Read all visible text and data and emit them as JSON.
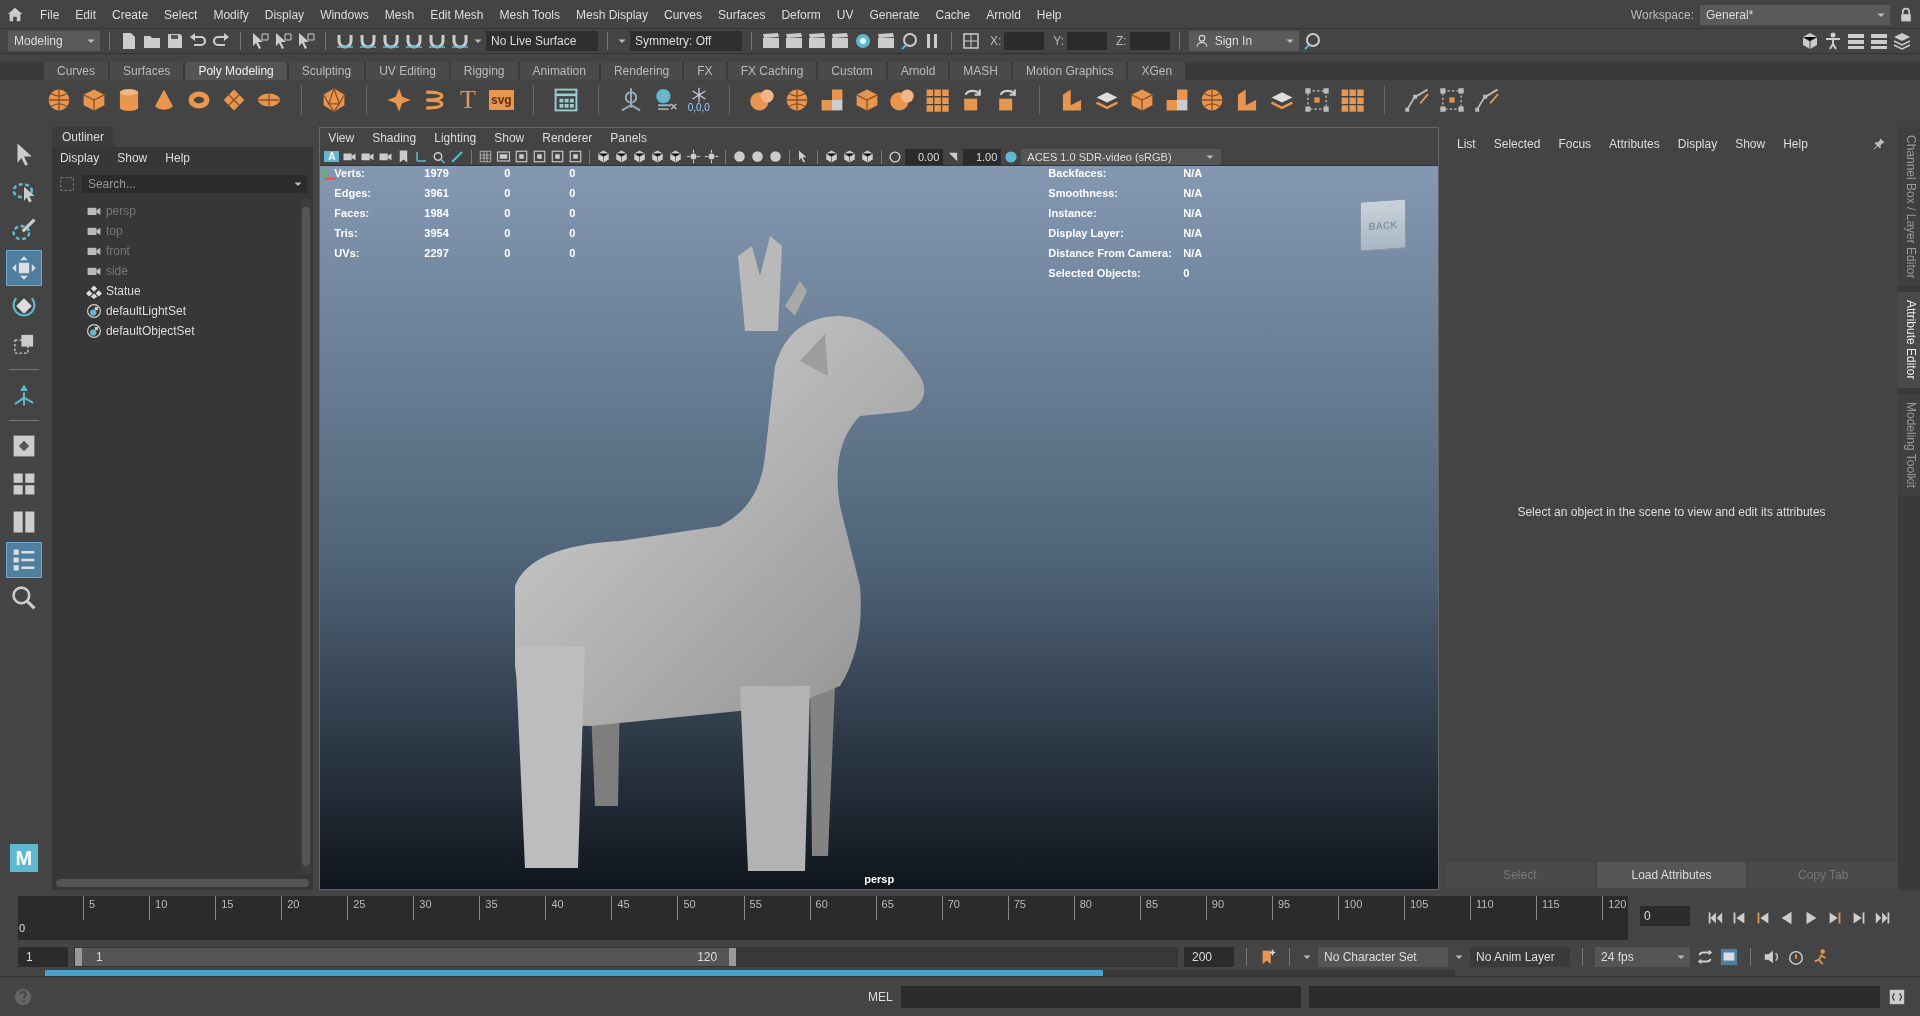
{
  "menu_bar": {
    "items": [
      "File",
      "Edit",
      "Create",
      "Select",
      "Modify",
      "Display",
      "Windows",
      "Mesh",
      "Edit Mesh",
      "Mesh Tools",
      "Mesh Display",
      "Curves",
      "Surfaces",
      "Deform",
      "UV",
      "Generate",
      "Cache",
      "Arnold",
      "Help"
    ],
    "workspace_label": "Workspace:",
    "workspace": "General*"
  },
  "status_line": {
    "mode": "Modeling",
    "live_surface": "No Live Surface",
    "symmetry": "Symmetry: Off",
    "coord_labels": [
      "X:",
      "Y:",
      "Z:"
    ],
    "sign_in": "Sign In"
  },
  "shelf": {
    "tabs": [
      {
        "label": "Curves",
        "selected": false
      },
      {
        "label": "Surfaces",
        "selected": false
      },
      {
        "label": "Poly Modeling",
        "selected": true
      },
      {
        "label": "Sculpting",
        "selected": false
      },
      {
        "label": "UV Editing",
        "selected": false
      },
      {
        "label": "Rigging",
        "selected": false
      },
      {
        "label": "Animation",
        "selected": false
      },
      {
        "label": "Rendering",
        "selected": false
      },
      {
        "label": "FX",
        "selected": false
      },
      {
        "label": "FX Caching",
        "selected": false
      },
      {
        "label": "Custom",
        "selected": false
      },
      {
        "label": "Arnold",
        "selected": false
      },
      {
        "label": "MASH",
        "selected": false
      },
      {
        "label": "Motion Graphics",
        "selected": false
      },
      {
        "label": "XGen",
        "selected": false
      }
    ],
    "icons": [
      {
        "kind": "sphere"
      },
      {
        "kind": "cube"
      },
      {
        "kind": "cylinder"
      },
      {
        "kind": "cone"
      },
      {
        "kind": "torus"
      },
      {
        "kind": "diamond"
      },
      {
        "kind": "disc"
      },
      {
        "kind": "separator"
      },
      {
        "kind": "poly"
      },
      {
        "kind": "separator"
      },
      {
        "kind": "star"
      },
      {
        "kind": "helix"
      },
      {
        "kind": "glyph",
        "text": "T"
      },
      {
        "kind": "badge",
        "text": "svg"
      },
      {
        "kind": "separator"
      },
      {
        "kind": "panel"
      },
      {
        "kind": "separator"
      },
      {
        "kind": "pivot"
      },
      {
        "kind": "clock"
      },
      {
        "kind": "snap",
        "text": "0,0,0"
      },
      {
        "kind": "separator"
      },
      {
        "kind": "blob"
      },
      {
        "kind": "sphere"
      },
      {
        "kind": "blocks"
      },
      {
        "kind": "cube"
      },
      {
        "kind": "blob"
      },
      {
        "kind": "grid"
      },
      {
        "kind": "cycle"
      },
      {
        "kind": "cycle"
      },
      {
        "kind": "separator"
      },
      {
        "kind": "wedge"
      },
      {
        "kind": "layers"
      },
      {
        "kind": "cube"
      },
      {
        "kind": "blocks"
      },
      {
        "kind": "sphere"
      },
      {
        "kind": "wedge"
      },
      {
        "kind": "layers"
      },
      {
        "kind": "frame"
      },
      {
        "kind": "grid"
      },
      {
        "kind": "separator"
      },
      {
        "kind": "pen"
      },
      {
        "kind": "frame"
      },
      {
        "kind": "pen"
      }
    ]
  },
  "toolbox": {
    "tools": [
      {
        "kind": "select",
        "selected": false
      },
      {
        "kind": "lasso",
        "selected": false
      },
      {
        "kind": "paint",
        "selected": false
      },
      {
        "kind": "move",
        "selected": true
      },
      {
        "kind": "rotate",
        "selected": false
      },
      {
        "kind": "scale",
        "selected": false
      },
      {
        "kind": "separator"
      },
      {
        "kind": "manipulator",
        "selected": false
      },
      {
        "kind": "separator"
      },
      {
        "kind": "single",
        "selected": false
      },
      {
        "kind": "four",
        "selected": false
      },
      {
        "kind": "two",
        "selected": false
      },
      {
        "kind": "outliner",
        "selected": true
      },
      {
        "kind": "search",
        "selected": false
      }
    ],
    "logo": "M"
  },
  "outliner": {
    "title": "Outliner",
    "menu": [
      "Display",
      "Show",
      "Help"
    ],
    "search_placeholder": "Search...",
    "items": [
      {
        "label": "persp",
        "kind": "camera",
        "hidden": true
      },
      {
        "label": "top",
        "kind": "camera",
        "hidden": true
      },
      {
        "label": "front",
        "kind": "camera",
        "hidden": true
      },
      {
        "label": "side",
        "kind": "camera",
        "hidden": true
      },
      {
        "label": "Statue",
        "kind": "mesh",
        "hidden": false
      },
      {
        "label": "defaultLightSet",
        "kind": "set",
        "hidden": false
      },
      {
        "label": "defaultObjectSet",
        "kind": "set",
        "hidden": false
      }
    ]
  },
  "viewport": {
    "menu": [
      "View",
      "Shading",
      "Lighting",
      "Show",
      "Renderer",
      "Panels"
    ],
    "display_button": "A",
    "exposure": "0.00",
    "gamma": "1.00",
    "color_space": "ACES 1.0 SDR-video (sRGB)",
    "hud_left": [
      {
        "label": "Verts:",
        "values": [
          "1979",
          "0",
          "0"
        ]
      },
      {
        "label": "Edges:",
        "values": [
          "3961",
          "0",
          "0"
        ]
      },
      {
        "label": "Faces:",
        "values": [
          "1984",
          "0",
          "0"
        ]
      },
      {
        "label": "Tris:",
        "values": [
          "3954",
          "0",
          "0"
        ]
      },
      {
        "label": "UVs:",
        "values": [
          "2297",
          "0",
          "0"
        ]
      }
    ],
    "hud_right": [
      {
        "label": "Backfaces:",
        "value": "N/A"
      },
      {
        "label": "Smoothness:",
        "value": "N/A"
      },
      {
        "label": "Instance:",
        "value": "N/A"
      },
      {
        "label": "Display Layer:",
        "value": "N/A"
      },
      {
        "label": "Distance From Camera:",
        "value": "N/A"
      },
      {
        "label": "Selected Objects:",
        "value": "0"
      }
    ],
    "view_cube": "BACK",
    "camera": "persp"
  },
  "attribute_editor": {
    "menu": [
      "List",
      "Selected",
      "Focus",
      "Attributes",
      "Display",
      "Show",
      "Help"
    ],
    "message": "Select an object in the scene to view and edit its attributes",
    "buttons": [
      {
        "label": "Select",
        "disabled": true
      },
      {
        "label": "Load Attributes",
        "disabled": false
      },
      {
        "label": "Copy Tab",
        "disabled": true
      }
    ]
  },
  "side_tabs": [
    {
      "label": "Channel Box / Layer Editor",
      "selected": false
    },
    {
      "label": "Attribute Editor",
      "selected": true
    },
    {
      "label": "Modeling Toolkit",
      "selected": false
    }
  ],
  "time_slider": {
    "start": "0",
    "ticks": [
      "5",
      "10",
      "15",
      "20",
      "25",
      "30",
      "35",
      "40",
      "45",
      "50",
      "55",
      "60",
      "65",
      "70",
      "75",
      "80",
      "85",
      "90",
      "95",
      "100",
      "105",
      "110",
      "115",
      "120"
    ],
    "current_frame": "0"
  },
  "range_slider": {
    "start": "1",
    "range_start": "1",
    "range_end": "120",
    "end": "200",
    "level": 0.6,
    "character_set": "No Character Set",
    "anim_layer": "No Anim Layer",
    "fps": "24 fps",
    "cache": {
      "level": 0.75
    }
  },
  "command_line": {
    "language": "MEL"
  }
}
